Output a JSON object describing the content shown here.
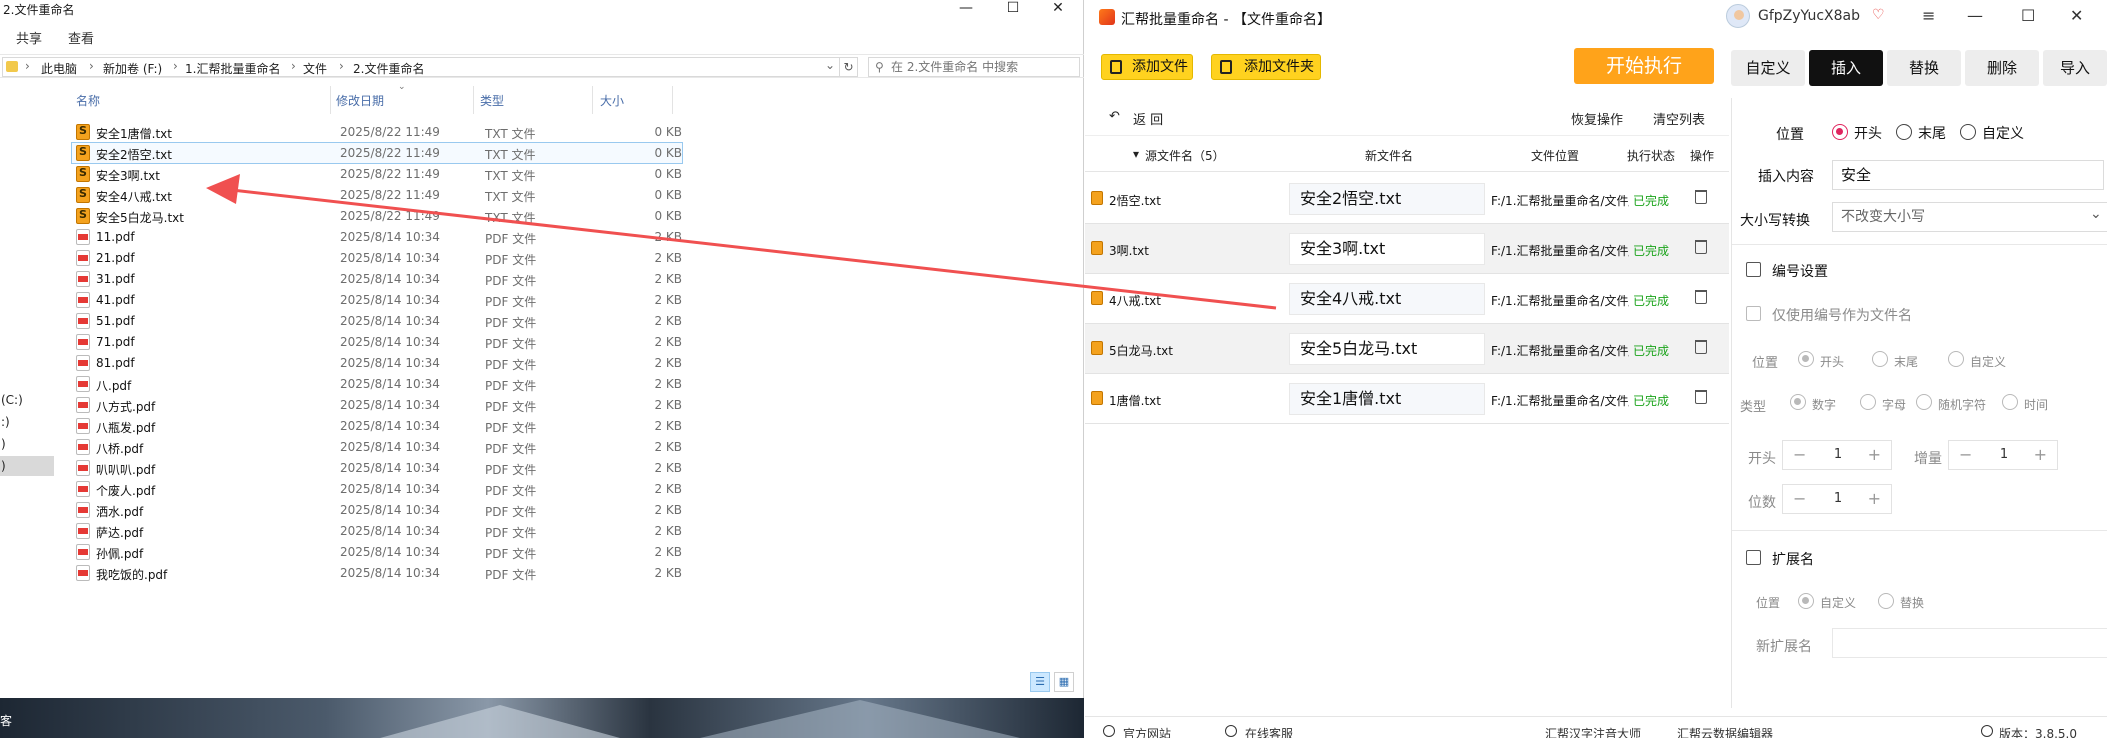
{
  "explorer": {
    "title": "2.文件重命名",
    "ribbon": [
      "共享",
      "查看"
    ],
    "breadcrumb": [
      "此电脑",
      "新加卷 (F:)",
      "1.汇帮批量重命名",
      "文件",
      "2.文件重命名"
    ],
    "search_placeholder": "在 2.文件重命名 中搜索",
    "nav_items": [
      "(C:)",
      ":)",
      ")",
      ")"
    ],
    "columns": [
      "名称",
      "修改日期",
      "类型",
      "大小"
    ],
    "files": [
      {
        "name": "安全1唐僧.txt",
        "date": "2025/8/22 11:49",
        "type": "TXT 文件",
        "size": "0 KB",
        "icon": "txt"
      },
      {
        "name": "安全2悟空.txt",
        "date": "2025/8/22 11:49",
        "type": "TXT 文件",
        "size": "0 KB",
        "icon": "txt"
      },
      {
        "name": "安全3啊.txt",
        "date": "2025/8/22 11:49",
        "type": "TXT 文件",
        "size": "0 KB",
        "icon": "txt"
      },
      {
        "name": "安全4八戒.txt",
        "date": "2025/8/22 11:49",
        "type": "TXT 文件",
        "size": "0 KB",
        "icon": "txt"
      },
      {
        "name": "安全5白龙马.txt",
        "date": "2025/8/22 11:49",
        "type": "TXT 文件",
        "size": "0 KB",
        "icon": "txt"
      },
      {
        "name": "11.pdf",
        "date": "2025/8/14 10:34",
        "type": "PDF 文件",
        "size": "2 KB",
        "icon": "pdf"
      },
      {
        "name": "21.pdf",
        "date": "2025/8/14 10:34",
        "type": "PDF 文件",
        "size": "2 KB",
        "icon": "pdf"
      },
      {
        "name": "31.pdf",
        "date": "2025/8/14 10:34",
        "type": "PDF 文件",
        "size": "2 KB",
        "icon": "pdf"
      },
      {
        "name": "41.pdf",
        "date": "2025/8/14 10:34",
        "type": "PDF 文件",
        "size": "2 KB",
        "icon": "pdf"
      },
      {
        "name": "51.pdf",
        "date": "2025/8/14 10:34",
        "type": "PDF 文件",
        "size": "2 KB",
        "icon": "pdf"
      },
      {
        "name": "71.pdf",
        "date": "2025/8/14 10:34",
        "type": "PDF 文件",
        "size": "2 KB",
        "icon": "pdf"
      },
      {
        "name": "81.pdf",
        "date": "2025/8/14 10:34",
        "type": "PDF 文件",
        "size": "2 KB",
        "icon": "pdf"
      },
      {
        "name": "八.pdf",
        "date": "2025/8/14 10:34",
        "type": "PDF 文件",
        "size": "2 KB",
        "icon": "pdf"
      },
      {
        "name": "八方式.pdf",
        "date": "2025/8/14 10:34",
        "type": "PDF 文件",
        "size": "2 KB",
        "icon": "pdf"
      },
      {
        "name": "八瓶发.pdf",
        "date": "2025/8/14 10:34",
        "type": "PDF 文件",
        "size": "2 KB",
        "icon": "pdf"
      },
      {
        "name": "八桥.pdf",
        "date": "2025/8/14 10:34",
        "type": "PDF 文件",
        "size": "2 KB",
        "icon": "pdf"
      },
      {
        "name": "叭叭叭.pdf",
        "date": "2025/8/14 10:34",
        "type": "PDF 文件",
        "size": "2 KB",
        "icon": "pdf"
      },
      {
        "name": "个废人.pdf",
        "date": "2025/8/14 10:34",
        "type": "PDF 文件",
        "size": "2 KB",
        "icon": "pdf"
      },
      {
        "name": "洒水.pdf",
        "date": "2025/8/14 10:34",
        "type": "PDF 文件",
        "size": "2 KB",
        "icon": "pdf"
      },
      {
        "name": "萨达.pdf",
        "date": "2025/8/14 10:34",
        "type": "PDF 文件",
        "size": "2 KB",
        "icon": "pdf"
      },
      {
        "name": "孙佩.pdf",
        "date": "2025/8/14 10:34",
        "type": "PDF 文件",
        "size": "2 KB",
        "icon": "pdf"
      },
      {
        "name": "我吃饭的.pdf",
        "date": "2025/8/14 10:34",
        "type": "PDF 文件",
        "size": "2 KB",
        "icon": "pdf"
      }
    ],
    "desktop_text": "客"
  },
  "app": {
    "title": "汇帮批量重命名 - 【文件重命名】",
    "username": "GfpZyYucX8ab",
    "toolbar": {
      "add_file": "添加文件",
      "add_folder": "添加文件夹",
      "start": "开始执行",
      "modes": [
        "自定义",
        "插入",
        "替换",
        "删除",
        "导入"
      ],
      "active_mode": "插入"
    },
    "table_tools": {
      "back": "返 回",
      "restore": "恢复操作",
      "clear": "清空列表"
    },
    "headers": {
      "src": "源文件名（5）",
      "new": "新文件名",
      "path": "文件位置",
      "status": "执行状态",
      "op": "操作"
    },
    "rows": [
      {
        "src": "2悟空.txt",
        "new": "安全2悟空.txt",
        "path": "F:/1.汇帮批量重命名/文件/2.文件重命名",
        "status": "已完成"
      },
      {
        "src": "3啊.txt",
        "new": "安全3啊.txt",
        "path": "F:/1.汇帮批量重命名/文件/2.文件重命名",
        "status": "已完成"
      },
      {
        "src": "4八戒.txt",
        "new": "安全4八戒.txt",
        "path": "F:/1.汇帮批量重命名/文件/2.文件重命名",
        "status": "已完成"
      },
      {
        "src": "5白龙马.txt",
        "new": "安全5白龙马.txt",
        "path": "F:/1.汇帮批量重命名/文件/2.文件重命名",
        "status": "已完成"
      },
      {
        "src": "1唐僧.txt",
        "new": "安全1唐僧.txt",
        "path": "F:/1.汇帮批量重命名/文件/2.文件重命名",
        "status": "已完成"
      }
    ],
    "settings": {
      "position_label": "位置",
      "position_options": [
        "开头",
        "末尾",
        "自定义"
      ],
      "insert_label": "插入内容",
      "insert_value": "安全",
      "case_label": "大小写转换",
      "case_value": "不改变大小写",
      "numbering_label": "编号设置",
      "only_number_label": "仅使用编号作为文件名",
      "num_position_label": "位置",
      "num_position_options": [
        "开头",
        "末尾",
        "自定义"
      ],
      "type_label": "类型",
      "type_options": [
        "数字",
        "字母",
        "随机字符",
        "时间"
      ],
      "start_label": "开头",
      "start_value": "1",
      "increment_label": "增量",
      "increment_value": "1",
      "digits_label": "位数",
      "digits_value": "1",
      "ext_label": "扩展名",
      "ext_position_label": "位置",
      "ext_options": [
        "自定义",
        "替换"
      ],
      "new_ext_label": "新扩展名"
    },
    "statusbar": {
      "website": "官方网站",
      "support": "在线客服",
      "tool1": "汇帮汉字注音大师",
      "tool2": "汇帮云数据编辑器",
      "version": "版本：3.8.5.0"
    }
  },
  "colors": {
    "accent_yellow": "#ffd21f",
    "start_orange": "#ffa31a",
    "radio_pink": "#e0245e",
    "done_green": "#1aa31a",
    "annotation_red": "#f05050"
  }
}
